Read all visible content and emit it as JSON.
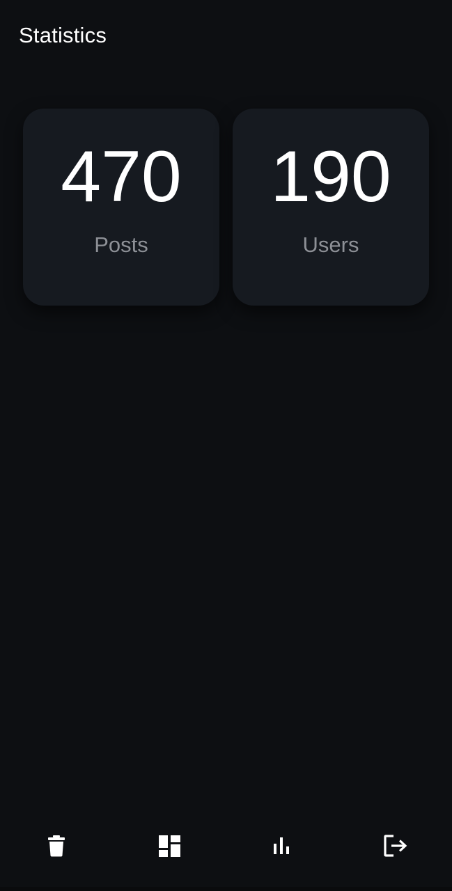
{
  "header": {
    "title": "Statistics"
  },
  "stats": [
    {
      "value": "470",
      "label": "Posts"
    },
    {
      "value": "190",
      "label": "Users"
    }
  ],
  "bottom_nav": {
    "items": [
      {
        "icon": "trash-icon"
      },
      {
        "icon": "dashboard-icon"
      },
      {
        "icon": "bar-chart-icon"
      },
      {
        "icon": "logout-icon"
      }
    ]
  },
  "colors": {
    "background": "#0d0f12",
    "card": "#161a20",
    "text_primary": "#ffffff",
    "text_secondary": "#8d9096"
  }
}
